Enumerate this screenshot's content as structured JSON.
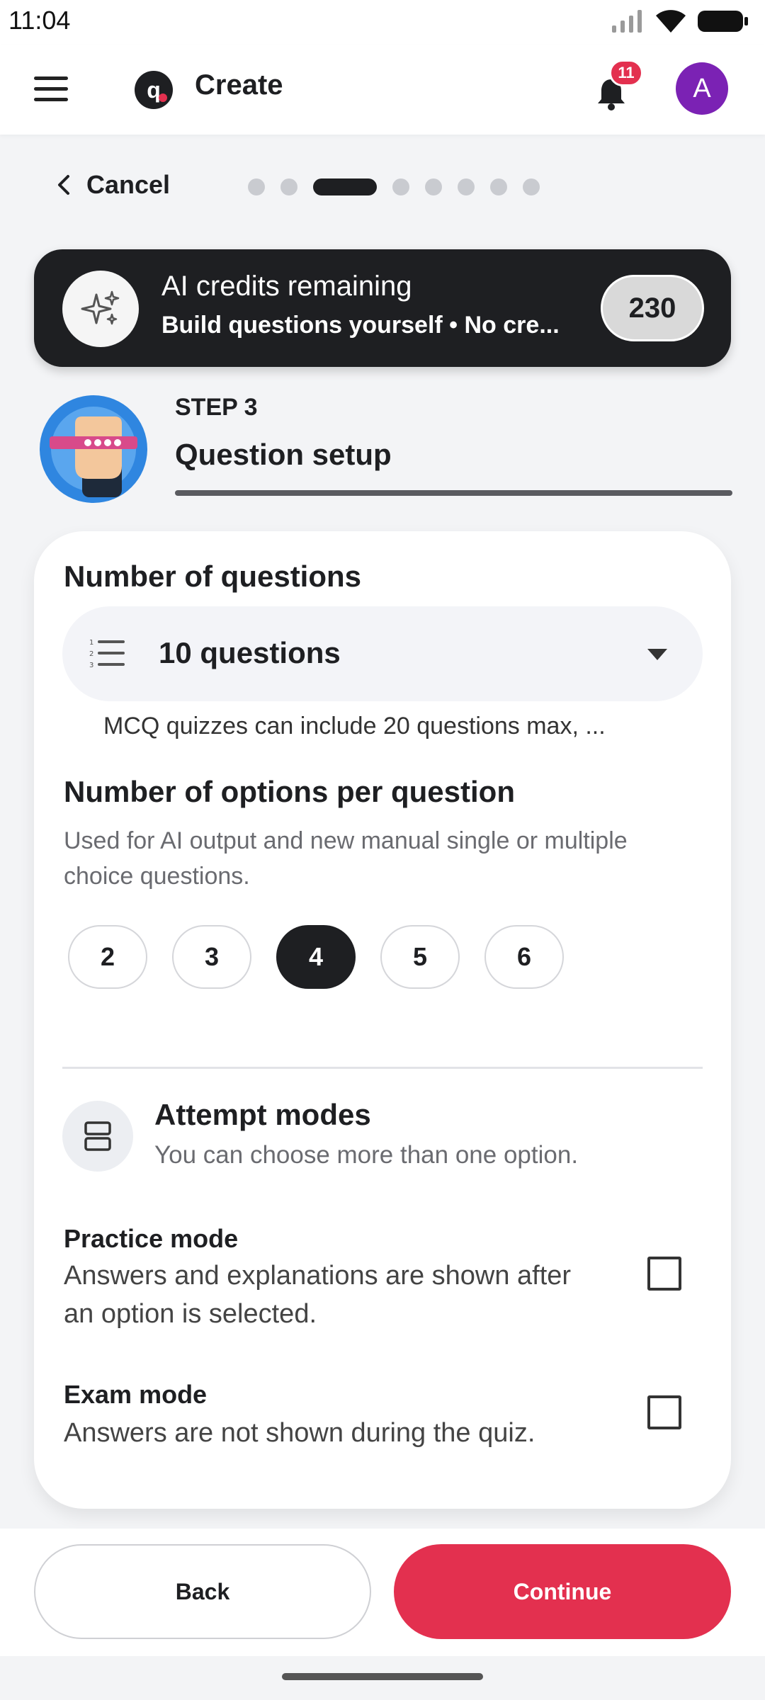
{
  "status_bar": {
    "time": "11:04"
  },
  "header": {
    "title": "Create",
    "logo_letter": "q",
    "notification_count": "11",
    "avatar_letter": "A"
  },
  "stepper": {
    "cancel_label": "Cancel",
    "total_steps": 8,
    "current_step": 3
  },
  "credits": {
    "title": "AI credits remaining",
    "subtitle": "Build questions yourself • No cre...",
    "count": "230"
  },
  "step": {
    "label": "STEP 3",
    "title": "Question setup"
  },
  "questions": {
    "title": "Number of questions",
    "selected": "10 questions",
    "hint": "MCQ quizzes can include 20 questions max, ..."
  },
  "options": {
    "title": "Number of options per question",
    "description": "Used for AI output and new manual single or multiple choice questions.",
    "values": [
      "2",
      "3",
      "4",
      "5",
      "6"
    ],
    "selected": "4"
  },
  "attempt_modes": {
    "title": "Attempt modes",
    "subtitle": "You can choose more than one option.",
    "modes": [
      {
        "title": "Practice mode",
        "description": "Answers and explanations are shown after an option is selected.",
        "checked": false
      },
      {
        "title": "Exam mode",
        "description": "Answers are not shown during the quiz.",
        "checked": false
      }
    ]
  },
  "footer": {
    "back_label": "Back",
    "continue_label": "Continue"
  },
  "colors": {
    "accent": "#e3304f",
    "dark": "#1e1f22",
    "avatar": "#7b22b4"
  }
}
